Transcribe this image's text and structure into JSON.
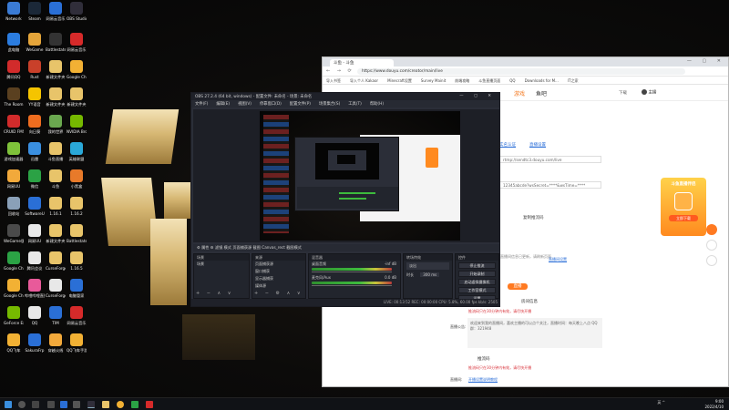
{
  "desktop": {
    "icons": [
      {
        "label": "Network",
        "color": "#3a7bd5"
      },
      {
        "label": "Steam",
        "color": "#1b2838"
      },
      {
        "label": "网易云音乐",
        "color": "#2a6fd6"
      },
      {
        "label": "OBS Studio",
        "color": "#302e3a"
      },
      {
        "label": "此电脑",
        "color": "#2b7de0"
      },
      {
        "label": "WeGame",
        "color": "#e5a53a"
      },
      {
        "label": "Battlestate Games L...",
        "color": "#333333"
      },
      {
        "label": "网易云音乐",
        "color": "#d62a2a"
      },
      {
        "label": "腾讯QQ",
        "color": "#d22b2b"
      },
      {
        "label": "Rust",
        "color": "#c9402a"
      },
      {
        "label": "新建文件夹",
        "color": "#e8c46a"
      },
      {
        "label": "Google Chrome",
        "color": "#f2b134"
      },
      {
        "label": "The Room",
        "color": "#5a4020"
      },
      {
        "label": "YY语音",
        "color": "#f5c400"
      },
      {
        "label": "新建文件夹",
        "color": "#e8c46a"
      },
      {
        "label": "新建文件夹",
        "color": "#e8c46a"
      },
      {
        "label": "CRUID FMSWorlds",
        "color": "#d22b2b"
      },
      {
        "label": "向日葵",
        "color": "#ef6d1f"
      },
      {
        "label": "我的世界",
        "color": "#6aa84f"
      },
      {
        "label": "NVIDIA Broadcast",
        "color": "#76b900"
      },
      {
        "label": "游戏加速器",
        "color": "#7fc23a"
      },
      {
        "label": "迅雷",
        "color": "#3a8fe0"
      },
      {
        "label": "斗鱼直播",
        "color": "#e8c46a"
      },
      {
        "label": "英雄联盟",
        "color": "#2aa8d8"
      },
      {
        "label": "网易UU",
        "color": "#f2a93b"
      },
      {
        "label": "微信",
        "color": "#2ba245"
      },
      {
        "label": "斗鱼",
        "color": "#e8c46a"
      },
      {
        "label": "小黑盒",
        "color": "#e87a2a"
      },
      {
        "label": "回收站",
        "color": "#8aa0b8"
      },
      {
        "label": "SoftwareU",
        "color": "#2a6fd6"
      },
      {
        "label": "1.16.1",
        "color": "#e8c46a"
      },
      {
        "label": "1.16.2",
        "color": "#e8c46a"
      },
      {
        "label": "WeGame版",
        "color": "#4a4a4a"
      },
      {
        "label": "网易UU",
        "color": "#e8e8e8"
      },
      {
        "label": "新建文件夹",
        "color": "#e8c46a"
      },
      {
        "label": "Battlestate",
        "color": "#e8c46a"
      },
      {
        "label": "Google Chrome",
        "color": "#2ba245"
      },
      {
        "label": "腾讯会议",
        "color": "#e8e8e8"
      },
      {
        "label": "CurseForge",
        "color": "#e8c46a"
      },
      {
        "label": "1.16.5",
        "color": "#e8c46a"
      },
      {
        "label": "Google Chrome",
        "color": "#f2b134"
      },
      {
        "label": "哔哩哔哩直播",
        "color": "#e85a9a"
      },
      {
        "label": "CurseForge",
        "color": "#e8e8e8"
      },
      {
        "label": "电脑管家",
        "color": "#2a6fd6"
      },
      {
        "label": "GeForce Experience",
        "color": "#76b900"
      },
      {
        "label": "QQ",
        "color": "#e8e8e8"
      },
      {
        "label": "TIM",
        "color": "#2a6fd6"
      },
      {
        "label": "网易云音乐",
        "color": "#d62a2a"
      },
      {
        "label": "QQ飞车",
        "color": "#f2b134"
      },
      {
        "label": "SakuraFrp",
        "color": "#2a6fd6"
      },
      {
        "label": "穿越火线",
        "color": "#f2a93b"
      },
      {
        "label": "QQ飞车手游",
        "color": "#f2b134"
      }
    ]
  },
  "browser": {
    "tab_title": "斗鱼 - 斗鱼",
    "url": "https://www.douyu.com/creator/main/live",
    "nav_controls": "← → ⟳",
    "window_controls": "— ▢ ✕",
    "bookmarks": [
      "导入书签",
      "导入个人 Kakaor",
      "Minecraft设置",
      "Survey Mainit",
      "前端攻略",
      "斗鱼直播页面",
      "QQ",
      "Downloads for M...",
      "IT之家"
    ],
    "site_nav": [
      "游戏",
      "鱼吧"
    ],
    "site_right": "下载",
    "user": "主播",
    "content": {
      "link1": "实名认证",
      "link2": "直播设置",
      "field1": "rtmp://sendtc3.douyu.com/live",
      "field2": "12345abcde?wsSecret=****&wsTime=****",
      "btn": "复制推流码",
      "note1": "直播间信息已更新，请刷新页面",
      "link3": "直播间设置",
      "section1": "房间信息",
      "red1": "推流码只在30分钟内有效，请尽快开播",
      "label1": "直播公告:",
      "announcement": "欢迎来到我的直播间，喜欢主播的可以点个关注，直播时间：每天晚上八点 QQ群：321948",
      "section2": "推流码",
      "red2": "推流码只在30分钟内有效，请尽快开播",
      "label2": "直播间:",
      "link4": "开播设置说明教程",
      "orange_tag": "直播",
      "side_banner": "斗鱼直播伴侣",
      "side_banner2": "立即下载"
    }
  },
  "obs": {
    "title": "OBS 27.2.4 (64 bit, windows) - 配置文件: 未命名 - 场景: 未命名",
    "window_controls": "— ▢ ✕",
    "menu": [
      "文件(F)",
      "编辑(E)",
      "视图(V)",
      "停靠窗口(D)",
      "配置文件(P)",
      "场景集合(S)",
      "工具(T)",
      "帮助(H)"
    ],
    "controls_bar": "⚙ 属性   ⚙ 滤镜   模式   页面捕获源   截图   Canvas_rect   截图模式",
    "docks": {
      "scenes": {
        "title": "场景",
        "items": [
          "场景"
        ]
      },
      "sources": {
        "title": "来源",
        "items": [
          "页面捕获源",
          "窗口捕获",
          "显示器捕获",
          "媒体源"
        ]
      },
      "mixer": {
        "title": "混音器",
        "items": [
          "桌面音频",
          "麦克风/Aux"
        ],
        "levels": [
          "-inf dB",
          "0.0 dB"
        ]
      },
      "transitions": {
        "title": "转场特效",
        "type": "淡出",
        "duration_label": "时长",
        "duration": "300 ms"
      },
      "controls": {
        "title": "控件",
        "buttons": [
          "停止推流",
          "开始录制",
          "启动虚拟摄像机",
          "工作室模式",
          "设置",
          "退出"
        ]
      }
    },
    "status": "LIVE: 00:13:52   REC: 00:00:00   CPU: 5.8%, 60.00 fps   kb/s: 2505"
  },
  "taskbar": {
    "tray_text": "英 ^",
    "time": "9:00",
    "date": "2022/4/10"
  }
}
